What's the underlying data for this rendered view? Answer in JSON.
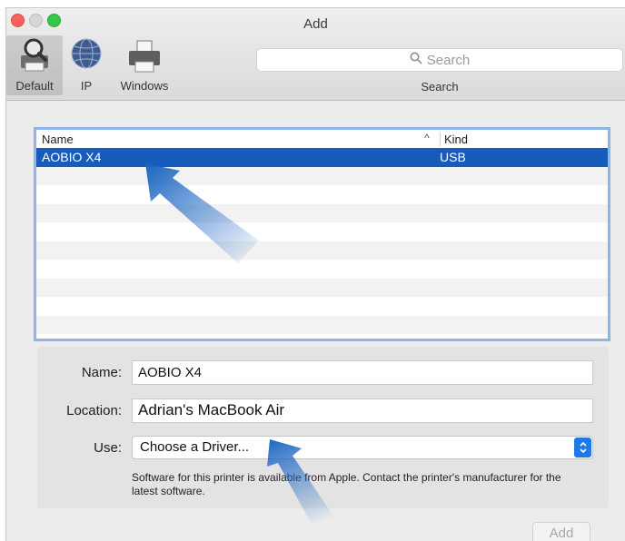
{
  "window": {
    "title": "Add"
  },
  "toolbar": {
    "tabs": [
      {
        "label": "Default",
        "icon": "default-printer-icon",
        "selected": true
      },
      {
        "label": "IP",
        "icon": "globe-icon",
        "selected": false
      },
      {
        "label": "Windows",
        "icon": "windows-printer-icon",
        "selected": false
      }
    ],
    "search": {
      "placeholder": "Search",
      "caption": "Search"
    }
  },
  "printer_list": {
    "columns": {
      "name": "Name",
      "kind": "Kind"
    },
    "sort_indicator": "^",
    "rows": [
      {
        "name": "AOBIO X4",
        "kind": "USB",
        "selected": true
      }
    ]
  },
  "form": {
    "name_label": "Name:",
    "name_value": "AOBIO X4",
    "location_label": "Location:",
    "location_value": "Adrian's MacBook Air",
    "use_label": "Use:",
    "use_value": "Choose a Driver...",
    "note": "Software for this printer is available from Apple. Contact the printer's manufacturer for the latest software."
  },
  "buttons": {
    "add_label": "Add"
  },
  "colors": {
    "selection": "#175cbd",
    "annotation_arrow": "#1c66c2",
    "focus_ring": "#8cb6e6"
  }
}
